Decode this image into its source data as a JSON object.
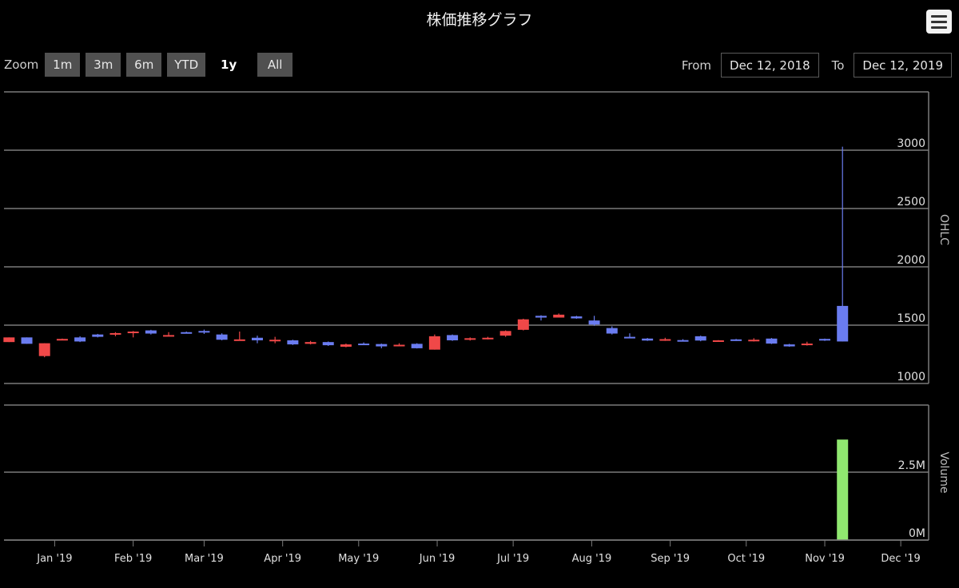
{
  "header": {
    "title": "株価推移グラフ",
    "menu_icon": "hamburger-menu-icon"
  },
  "range_selector": {
    "zoom_label": "Zoom",
    "buttons": [
      {
        "label": "1m",
        "active": false
      },
      {
        "label": "3m",
        "active": false
      },
      {
        "label": "6m",
        "active": false
      },
      {
        "label": "YTD",
        "active": false
      },
      {
        "label": "1y",
        "active": true
      },
      {
        "label": "All",
        "active": false
      }
    ],
    "from_label": "From",
    "from_value": "Dec 12, 2018",
    "to_label": "To",
    "to_value": "Dec 12, 2019"
  },
  "colors": {
    "up": "#f04848",
    "down": "#6a7cf0",
    "volume": "#90e870",
    "grid": "#7a7a7a",
    "background": "#000000"
  },
  "chart_data": [
    {
      "type": "candlestick",
      "title": "",
      "ylabel": "OHLC",
      "ylim": [
        1000,
        3250
      ],
      "yticks": [
        1000,
        1500,
        2000,
        2500,
        3000
      ],
      "grid": true,
      "x_range": [
        "2018-12-12",
        "2019-12-12"
      ],
      "xticks": [
        "Jan '19",
        "Feb '19",
        "Mar '19",
        "Apr '19",
        "May '19",
        "Jun '19",
        "Jul '19",
        "Aug '19",
        "Sep '19",
        "Oct '19",
        "Nov '19",
        "Dec '19"
      ],
      "xtick_dates": [
        "2019-01-01",
        "2019-02-01",
        "2019-03-01",
        "2019-04-01",
        "2019-05-01",
        "2019-06-01",
        "2019-07-01",
        "2019-08-01",
        "2019-09-01",
        "2019-10-01",
        "2019-11-01",
        "2019-12-01"
      ],
      "candles": [
        {
          "date": "2018-12-14",
          "open": 1355,
          "high": 1395,
          "low": 1355,
          "close": 1395
        },
        {
          "date": "2018-12-21",
          "open": 1395,
          "high": 1395,
          "low": 1340,
          "close": 1340
        },
        {
          "date": "2018-12-28",
          "open": 1235,
          "high": 1345,
          "low": 1225,
          "close": 1345
        },
        {
          "date": "2019-01-04",
          "open": 1378,
          "high": 1385,
          "low": 1375,
          "close": 1382
        },
        {
          "date": "2019-01-11",
          "open": 1395,
          "high": 1405,
          "low": 1355,
          "close": 1360
        },
        {
          "date": "2019-01-18",
          "open": 1420,
          "high": 1425,
          "low": 1395,
          "close": 1400
        },
        {
          "date": "2019-01-25",
          "open": 1420,
          "high": 1440,
          "low": 1405,
          "close": 1432
        },
        {
          "date": "2019-02-01",
          "open": 1435,
          "high": 1450,
          "low": 1395,
          "close": 1445
        },
        {
          "date": "2019-02-08",
          "open": 1455,
          "high": 1460,
          "low": 1420,
          "close": 1428
        },
        {
          "date": "2019-02-15",
          "open": 1405,
          "high": 1440,
          "low": 1405,
          "close": 1415
        },
        {
          "date": "2019-02-22",
          "open": 1440,
          "high": 1445,
          "low": 1430,
          "close": 1432
        },
        {
          "date": "2019-03-01",
          "open": 1450,
          "high": 1462,
          "low": 1425,
          "close": 1440
        },
        {
          "date": "2019-03-08",
          "open": 1420,
          "high": 1430,
          "low": 1370,
          "close": 1375
        },
        {
          "date": "2019-03-15",
          "open": 1370,
          "high": 1445,
          "low": 1370,
          "close": 1378
        },
        {
          "date": "2019-03-22",
          "open": 1392,
          "high": 1410,
          "low": 1345,
          "close": 1370
        },
        {
          "date": "2019-03-29",
          "open": 1362,
          "high": 1400,
          "low": 1345,
          "close": 1375
        },
        {
          "date": "2019-04-05",
          "open": 1370,
          "high": 1375,
          "low": 1330,
          "close": 1335
        },
        {
          "date": "2019-04-12",
          "open": 1340,
          "high": 1365,
          "low": 1335,
          "close": 1355
        },
        {
          "date": "2019-04-19",
          "open": 1355,
          "high": 1360,
          "low": 1322,
          "close": 1328
        },
        {
          "date": "2019-04-26",
          "open": 1315,
          "high": 1342,
          "low": 1310,
          "close": 1335
        },
        {
          "date": "2019-05-03",
          "open": 1342,
          "high": 1352,
          "low": 1332,
          "close": 1340
        },
        {
          "date": "2019-05-10",
          "open": 1338,
          "high": 1342,
          "low": 1302,
          "close": 1318
        },
        {
          "date": "2019-05-17",
          "open": 1330,
          "high": 1345,
          "low": 1320,
          "close": 1332
        },
        {
          "date": "2019-05-24",
          "open": 1340,
          "high": 1345,
          "low": 1300,
          "close": 1302
        },
        {
          "date": "2019-05-31",
          "open": 1290,
          "high": 1420,
          "low": 1290,
          "close": 1405
        },
        {
          "date": "2019-06-07",
          "open": 1415,
          "high": 1420,
          "low": 1365,
          "close": 1370
        },
        {
          "date": "2019-06-14",
          "open": 1382,
          "high": 1395,
          "low": 1368,
          "close": 1388
        },
        {
          "date": "2019-06-21",
          "open": 1382,
          "high": 1400,
          "low": 1378,
          "close": 1392
        },
        {
          "date": "2019-06-28",
          "open": 1410,
          "high": 1455,
          "low": 1400,
          "close": 1450
        },
        {
          "date": "2019-07-05",
          "open": 1460,
          "high": 1555,
          "low": 1455,
          "close": 1550
        },
        {
          "date": "2019-07-12",
          "open": 1580,
          "high": 1585,
          "low": 1540,
          "close": 1565
        },
        {
          "date": "2019-07-19",
          "open": 1565,
          "high": 1600,
          "low": 1565,
          "close": 1590
        },
        {
          "date": "2019-07-26",
          "open": 1575,
          "high": 1580,
          "low": 1555,
          "close": 1558
        },
        {
          "date": "2019-08-02",
          "open": 1540,
          "high": 1580,
          "low": 1495,
          "close": 1505
        },
        {
          "date": "2019-08-09",
          "open": 1475,
          "high": 1490,
          "low": 1420,
          "close": 1428
        },
        {
          "date": "2019-08-16",
          "open": 1400,
          "high": 1430,
          "low": 1395,
          "close": 1398
        },
        {
          "date": "2019-08-23",
          "open": 1385,
          "high": 1390,
          "low": 1365,
          "close": 1368
        },
        {
          "date": "2019-08-30",
          "open": 1368,
          "high": 1392,
          "low": 1365,
          "close": 1380
        },
        {
          "date": "2019-09-06",
          "open": 1372,
          "high": 1380,
          "low": 1365,
          "close": 1368
        },
        {
          "date": "2019-09-13",
          "open": 1405,
          "high": 1410,
          "low": 1362,
          "close": 1368
        },
        {
          "date": "2019-09-20",
          "open": 1362,
          "high": 1372,
          "low": 1360,
          "close": 1370
        },
        {
          "date": "2019-09-27",
          "open": 1378,
          "high": 1382,
          "low": 1365,
          "close": 1368
        },
        {
          "date": "2019-10-04",
          "open": 1365,
          "high": 1388,
          "low": 1360,
          "close": 1375
        },
        {
          "date": "2019-10-11",
          "open": 1385,
          "high": 1390,
          "low": 1338,
          "close": 1342
        },
        {
          "date": "2019-10-18",
          "open": 1335,
          "high": 1340,
          "low": 1315,
          "close": 1318
        },
        {
          "date": "2019-10-25",
          "open": 1330,
          "high": 1358,
          "low": 1325,
          "close": 1342
        },
        {
          "date": "2019-11-01",
          "open": 1382,
          "high": 1385,
          "low": 1365,
          "close": 1368
        },
        {
          "date": "2019-11-08",
          "open": 1665,
          "high": 3030,
          "low": 1360,
          "close": 1360
        }
      ]
    },
    {
      "type": "bar",
      "title": "",
      "ylabel": "Volume",
      "ylim": [
        0,
        4000000
      ],
      "yticks": [
        0,
        2500000
      ],
      "ytick_labels": [
        "0M",
        "2.5M"
      ],
      "series": [
        {
          "name": "Volume",
          "date": "2019-11-08",
          "value": 3700000
        }
      ]
    }
  ]
}
